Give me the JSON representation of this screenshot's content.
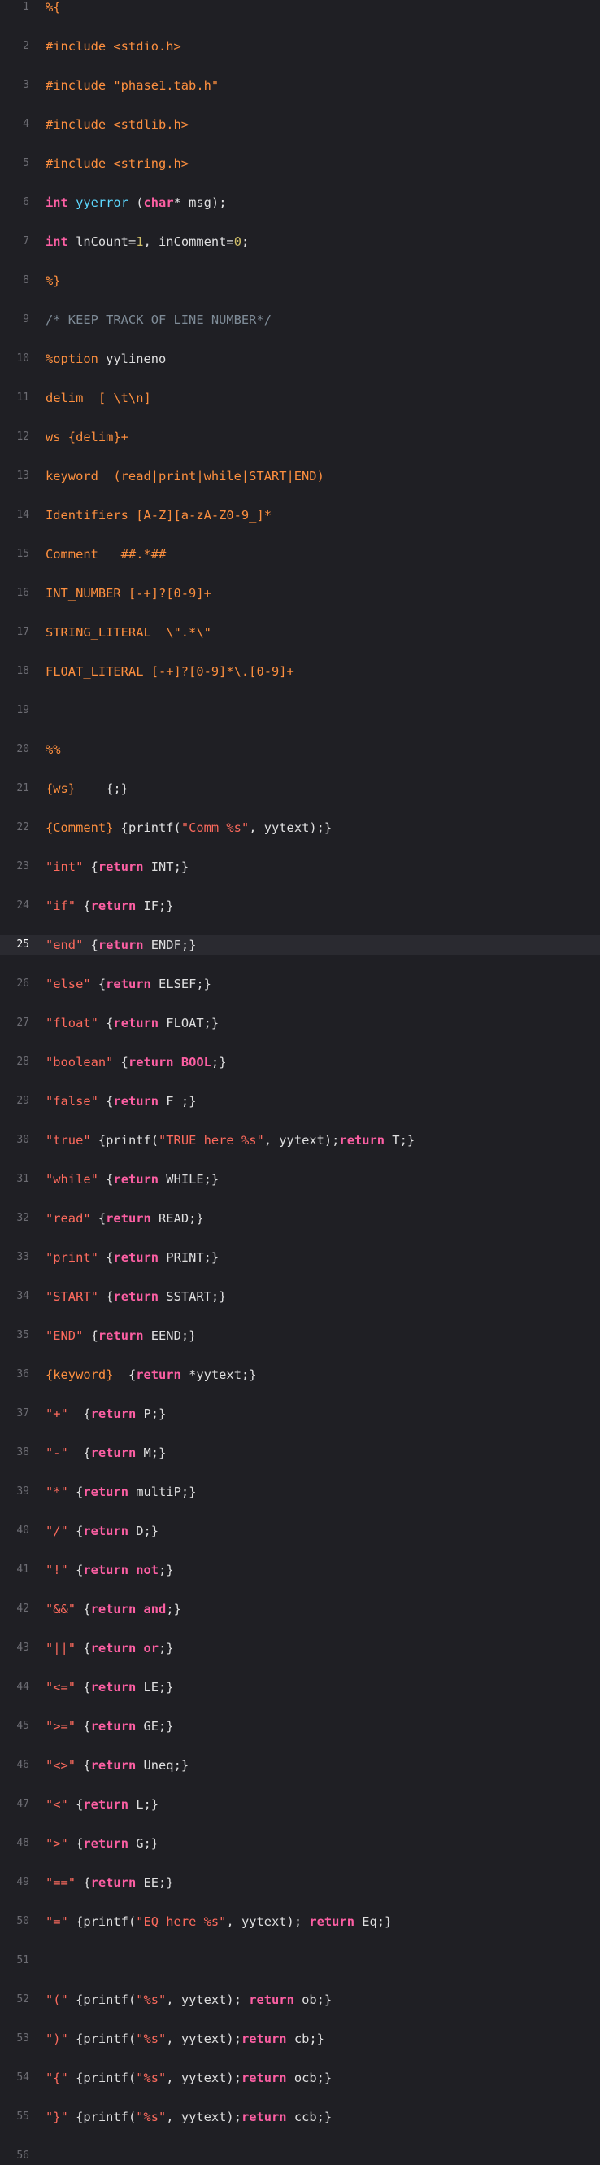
{
  "editor": {
    "current_line": 25,
    "lines": [
      {
        "n": "1",
        "segs": [
          {
            "t": "%{",
            "c": "pre"
          }
        ]
      },
      {
        "n": "2",
        "segs": [
          {
            "t": "#include <stdio.h>",
            "c": "pre"
          }
        ]
      },
      {
        "n": "3",
        "segs": [
          {
            "t": "#include \"phase1.tab.h\"",
            "c": "pre"
          }
        ]
      },
      {
        "n": "4",
        "segs": [
          {
            "t": "#include <stdlib.h>",
            "c": "pre"
          }
        ]
      },
      {
        "n": "5",
        "segs": [
          {
            "t": "#include <string.h>",
            "c": "pre"
          }
        ]
      },
      {
        "n": "6",
        "segs": [
          {
            "t": "int",
            "c": "kw"
          },
          {
            "t": " ",
            "c": "plain"
          },
          {
            "t": "yyerror",
            "c": "fn"
          },
          {
            "t": " (",
            "c": "plain"
          },
          {
            "t": "char",
            "c": "kw"
          },
          {
            "t": "* msg);",
            "c": "plain"
          }
        ]
      },
      {
        "n": "7",
        "segs": [
          {
            "t": "int",
            "c": "kw"
          },
          {
            "t": " lnCount=",
            "c": "plain"
          },
          {
            "t": "1",
            "c": "num"
          },
          {
            "t": ", inComment=",
            "c": "plain"
          },
          {
            "t": "0",
            "c": "num"
          },
          {
            "t": ";",
            "c": "plain"
          }
        ]
      },
      {
        "n": "8",
        "segs": [
          {
            "t": "%}",
            "c": "pre"
          }
        ]
      },
      {
        "n": "9",
        "segs": [
          {
            "t": "/* KEEP TRACK OF LINE NUMBER*/",
            "c": "com"
          }
        ]
      },
      {
        "n": "10",
        "segs": [
          {
            "t": "%option",
            "c": "pre"
          },
          {
            "t": " yylineno",
            "c": "plain"
          }
        ]
      },
      {
        "n": "11",
        "segs": [
          {
            "t": "delim  [ \\t\\n]",
            "c": "pre"
          }
        ]
      },
      {
        "n": "12",
        "segs": [
          {
            "t": "ws {delim}+",
            "c": "pre"
          }
        ]
      },
      {
        "n": "13",
        "segs": [
          {
            "t": "keyword  (read|print|while|START|END)",
            "c": "pre"
          }
        ]
      },
      {
        "n": "14",
        "segs": [
          {
            "t": "Identifiers [A-Z][a-zA-Z0-9_]*",
            "c": "pre"
          }
        ]
      },
      {
        "n": "15",
        "segs": [
          {
            "t": "Comment   ##.*##",
            "c": "pre"
          }
        ]
      },
      {
        "n": "16",
        "segs": [
          {
            "t": "INT_NUMBER [-+]?[0-9]+",
            "c": "pre"
          }
        ]
      },
      {
        "n": "17",
        "segs": [
          {
            "t": "STRING_LITERAL  \\\".*\\\"",
            "c": "pre"
          }
        ]
      },
      {
        "n": "18",
        "segs": [
          {
            "t": "FLOAT_LITERAL [-+]?[0-9]*\\.[0-9]+",
            "c": "pre"
          }
        ]
      },
      {
        "n": "19",
        "segs": []
      },
      {
        "n": "20",
        "segs": [
          {
            "t": "%%",
            "c": "pre"
          }
        ]
      },
      {
        "n": "21",
        "segs": [
          {
            "t": "{ws}",
            "c": "pre"
          },
          {
            "t": "    {;}",
            "c": "plain"
          }
        ]
      },
      {
        "n": "22",
        "segs": [
          {
            "t": "{Comment}",
            "c": "pre"
          },
          {
            "t": " {printf(",
            "c": "plain"
          },
          {
            "t": "\"Comm %s\"",
            "c": "str"
          },
          {
            "t": ", yytext);}",
            "c": "plain"
          }
        ]
      },
      {
        "n": "23",
        "segs": [
          {
            "t": "\"int\"",
            "c": "str"
          },
          {
            "t": " {",
            "c": "plain"
          },
          {
            "t": "return",
            "c": "kw"
          },
          {
            "t": " INT;}",
            "c": "plain"
          }
        ]
      },
      {
        "n": "24",
        "segs": [
          {
            "t": "\"if\"",
            "c": "str"
          },
          {
            "t": " {",
            "c": "plain"
          },
          {
            "t": "return",
            "c": "kw"
          },
          {
            "t": " IF;}",
            "c": "plain"
          }
        ]
      },
      {
        "n": "25",
        "segs": [
          {
            "t": "\"end\"",
            "c": "str"
          },
          {
            "t": " {",
            "c": "plain"
          },
          {
            "t": "return",
            "c": "kw"
          },
          {
            "t": " ENDF;}",
            "c": "plain"
          }
        ]
      },
      {
        "n": "26",
        "segs": [
          {
            "t": "\"else\"",
            "c": "str"
          },
          {
            "t": " {",
            "c": "plain"
          },
          {
            "t": "return",
            "c": "kw"
          },
          {
            "t": " ELSEF;}",
            "c": "plain"
          }
        ]
      },
      {
        "n": "27",
        "segs": [
          {
            "t": "\"float\"",
            "c": "str"
          },
          {
            "t": " {",
            "c": "plain"
          },
          {
            "t": "return",
            "c": "kw"
          },
          {
            "t": " FLOAT;}",
            "c": "plain"
          }
        ]
      },
      {
        "n": "28",
        "segs": [
          {
            "t": "\"boolean\"",
            "c": "str"
          },
          {
            "t": " {",
            "c": "plain"
          },
          {
            "t": "return",
            "c": "kw"
          },
          {
            "t": " ",
            "c": "plain"
          },
          {
            "t": "BOOL",
            "c": "kw"
          },
          {
            "t": ";}",
            "c": "plain"
          }
        ]
      },
      {
        "n": "29",
        "segs": [
          {
            "t": "\"false\"",
            "c": "str"
          },
          {
            "t": " {",
            "c": "plain"
          },
          {
            "t": "return",
            "c": "kw"
          },
          {
            "t": " F ;}",
            "c": "plain"
          }
        ]
      },
      {
        "n": "30",
        "segs": [
          {
            "t": "\"true\"",
            "c": "str"
          },
          {
            "t": " {printf(",
            "c": "plain"
          },
          {
            "t": "\"TRUE here %s\"",
            "c": "str"
          },
          {
            "t": ", yytext);",
            "c": "plain"
          },
          {
            "t": "return",
            "c": "kw"
          },
          {
            "t": " T;}",
            "c": "plain"
          }
        ]
      },
      {
        "n": "31",
        "segs": [
          {
            "t": "\"while\"",
            "c": "str"
          },
          {
            "t": " {",
            "c": "plain"
          },
          {
            "t": "return",
            "c": "kw"
          },
          {
            "t": " WHILE;}",
            "c": "plain"
          }
        ]
      },
      {
        "n": "32",
        "segs": [
          {
            "t": "\"read\"",
            "c": "str"
          },
          {
            "t": " {",
            "c": "plain"
          },
          {
            "t": "return",
            "c": "kw"
          },
          {
            "t": " READ;}",
            "c": "plain"
          }
        ]
      },
      {
        "n": "33",
        "segs": [
          {
            "t": "\"print\"",
            "c": "str"
          },
          {
            "t": " {",
            "c": "plain"
          },
          {
            "t": "return",
            "c": "kw"
          },
          {
            "t": " PRINT;}",
            "c": "plain"
          }
        ]
      },
      {
        "n": "34",
        "segs": [
          {
            "t": "\"START\"",
            "c": "str"
          },
          {
            "t": " {",
            "c": "plain"
          },
          {
            "t": "return",
            "c": "kw"
          },
          {
            "t": " SSTART;}",
            "c": "plain"
          }
        ]
      },
      {
        "n": "35",
        "segs": [
          {
            "t": "\"END\"",
            "c": "str"
          },
          {
            "t": " {",
            "c": "plain"
          },
          {
            "t": "return",
            "c": "kw"
          },
          {
            "t": " EEND;}",
            "c": "plain"
          }
        ]
      },
      {
        "n": "36",
        "segs": [
          {
            "t": "{keyword}",
            "c": "pre"
          },
          {
            "t": "  {",
            "c": "plain"
          },
          {
            "t": "return",
            "c": "kw"
          },
          {
            "t": " *yytext;}",
            "c": "plain"
          }
        ]
      },
      {
        "n": "37",
        "segs": [
          {
            "t": "\"+\"",
            "c": "str"
          },
          {
            "t": "  {",
            "c": "plain"
          },
          {
            "t": "return",
            "c": "kw"
          },
          {
            "t": " P;}",
            "c": "plain"
          }
        ]
      },
      {
        "n": "38",
        "segs": [
          {
            "t": "\"-\"",
            "c": "str"
          },
          {
            "t": "  {",
            "c": "plain"
          },
          {
            "t": "return",
            "c": "kw"
          },
          {
            "t": " M;}",
            "c": "plain"
          }
        ]
      },
      {
        "n": "39",
        "segs": [
          {
            "t": "\"*\"",
            "c": "str"
          },
          {
            "t": " {",
            "c": "plain"
          },
          {
            "t": "return",
            "c": "kw"
          },
          {
            "t": " multiP;}",
            "c": "plain"
          }
        ]
      },
      {
        "n": "40",
        "segs": [
          {
            "t": "\"/\"",
            "c": "str"
          },
          {
            "t": " {",
            "c": "plain"
          },
          {
            "t": "return",
            "c": "kw"
          },
          {
            "t": " D;}",
            "c": "plain"
          }
        ]
      },
      {
        "n": "41",
        "segs": [
          {
            "t": "\"!\"",
            "c": "str"
          },
          {
            "t": " {",
            "c": "plain"
          },
          {
            "t": "return",
            "c": "kw"
          },
          {
            "t": " ",
            "c": "plain"
          },
          {
            "t": "not",
            "c": "kw"
          },
          {
            "t": ";}",
            "c": "plain"
          }
        ]
      },
      {
        "n": "42",
        "segs": [
          {
            "t": "\"&&\"",
            "c": "str"
          },
          {
            "t": " {",
            "c": "plain"
          },
          {
            "t": "return",
            "c": "kw"
          },
          {
            "t": " ",
            "c": "plain"
          },
          {
            "t": "and",
            "c": "kw"
          },
          {
            "t": ";}",
            "c": "plain"
          }
        ]
      },
      {
        "n": "43",
        "segs": [
          {
            "t": "\"||\"",
            "c": "str"
          },
          {
            "t": " {",
            "c": "plain"
          },
          {
            "t": "return",
            "c": "kw"
          },
          {
            "t": " ",
            "c": "plain"
          },
          {
            "t": "or",
            "c": "kw"
          },
          {
            "t": ";}",
            "c": "plain"
          }
        ]
      },
      {
        "n": "44",
        "segs": [
          {
            "t": "\"<=\"",
            "c": "str"
          },
          {
            "t": " {",
            "c": "plain"
          },
          {
            "t": "return",
            "c": "kw"
          },
          {
            "t": " LE;}",
            "c": "plain"
          }
        ]
      },
      {
        "n": "45",
        "segs": [
          {
            "t": "\">=\"",
            "c": "str"
          },
          {
            "t": " {",
            "c": "plain"
          },
          {
            "t": "return",
            "c": "kw"
          },
          {
            "t": " GE;}",
            "c": "plain"
          }
        ]
      },
      {
        "n": "46",
        "segs": [
          {
            "t": "\"<>\"",
            "c": "str"
          },
          {
            "t": " {",
            "c": "plain"
          },
          {
            "t": "return",
            "c": "kw"
          },
          {
            "t": " Uneq;}",
            "c": "plain"
          }
        ]
      },
      {
        "n": "47",
        "segs": [
          {
            "t": "\"<\"",
            "c": "str"
          },
          {
            "t": " {",
            "c": "plain"
          },
          {
            "t": "return",
            "c": "kw"
          },
          {
            "t": " L;}",
            "c": "plain"
          }
        ]
      },
      {
        "n": "48",
        "segs": [
          {
            "t": "\">\"",
            "c": "str"
          },
          {
            "t": " {",
            "c": "plain"
          },
          {
            "t": "return",
            "c": "kw"
          },
          {
            "t": " G;}",
            "c": "plain"
          }
        ]
      },
      {
        "n": "49",
        "segs": [
          {
            "t": "\"==\"",
            "c": "str"
          },
          {
            "t": " {",
            "c": "plain"
          },
          {
            "t": "return",
            "c": "kw"
          },
          {
            "t": " EE;}",
            "c": "plain"
          }
        ]
      },
      {
        "n": "50",
        "segs": [
          {
            "t": "\"=\"",
            "c": "str"
          },
          {
            "t": " {printf(",
            "c": "plain"
          },
          {
            "t": "\"EQ here %s\"",
            "c": "str"
          },
          {
            "t": ", yytext); ",
            "c": "plain"
          },
          {
            "t": "return",
            "c": "kw"
          },
          {
            "t": " Eq;}",
            "c": "plain"
          }
        ]
      },
      {
        "n": "51",
        "segs": []
      },
      {
        "n": "52",
        "segs": [
          {
            "t": "\"(\"",
            "c": "str"
          },
          {
            "t": " {printf(",
            "c": "plain"
          },
          {
            "t": "\"%s\"",
            "c": "str"
          },
          {
            "t": ", yytext); ",
            "c": "plain"
          },
          {
            "t": "return",
            "c": "kw"
          },
          {
            "t": " ob;}",
            "c": "plain"
          }
        ]
      },
      {
        "n": "53",
        "segs": [
          {
            "t": "\")\"",
            "c": "str"
          },
          {
            "t": " {printf(",
            "c": "plain"
          },
          {
            "t": "\"%s\"",
            "c": "str"
          },
          {
            "t": ", yytext);",
            "c": "plain"
          },
          {
            "t": "return",
            "c": "kw"
          },
          {
            "t": " cb;}",
            "c": "plain"
          }
        ]
      },
      {
        "n": "54",
        "segs": [
          {
            "t": "\"{\"",
            "c": "str"
          },
          {
            "t": " {printf(",
            "c": "plain"
          },
          {
            "t": "\"%s\"",
            "c": "str"
          },
          {
            "t": ", yytext);",
            "c": "plain"
          },
          {
            "t": "return",
            "c": "kw"
          },
          {
            "t": " ocb;}",
            "c": "plain"
          }
        ]
      },
      {
        "n": "55",
        "segs": [
          {
            "t": "\"}\"",
            "c": "str"
          },
          {
            "t": " {printf(",
            "c": "plain"
          },
          {
            "t": "\"%s\"",
            "c": "str"
          },
          {
            "t": ", yytext);",
            "c": "plain"
          },
          {
            "t": "return",
            "c": "kw"
          },
          {
            "t": " ccb;}",
            "c": "plain"
          }
        ]
      },
      {
        "n": "56",
        "segs": []
      }
    ]
  },
  "colors": {
    "background": "#1f1f24",
    "current_line_background": "#2a2a30",
    "plain": "#dfdfe0",
    "preprocessor": "#fd8f3f",
    "keyword": "#fc5fa3",
    "string": "#fc6a5d",
    "comment": "#7f8c98",
    "number": "#d0bf69",
    "function": "#5dd8ff"
  }
}
